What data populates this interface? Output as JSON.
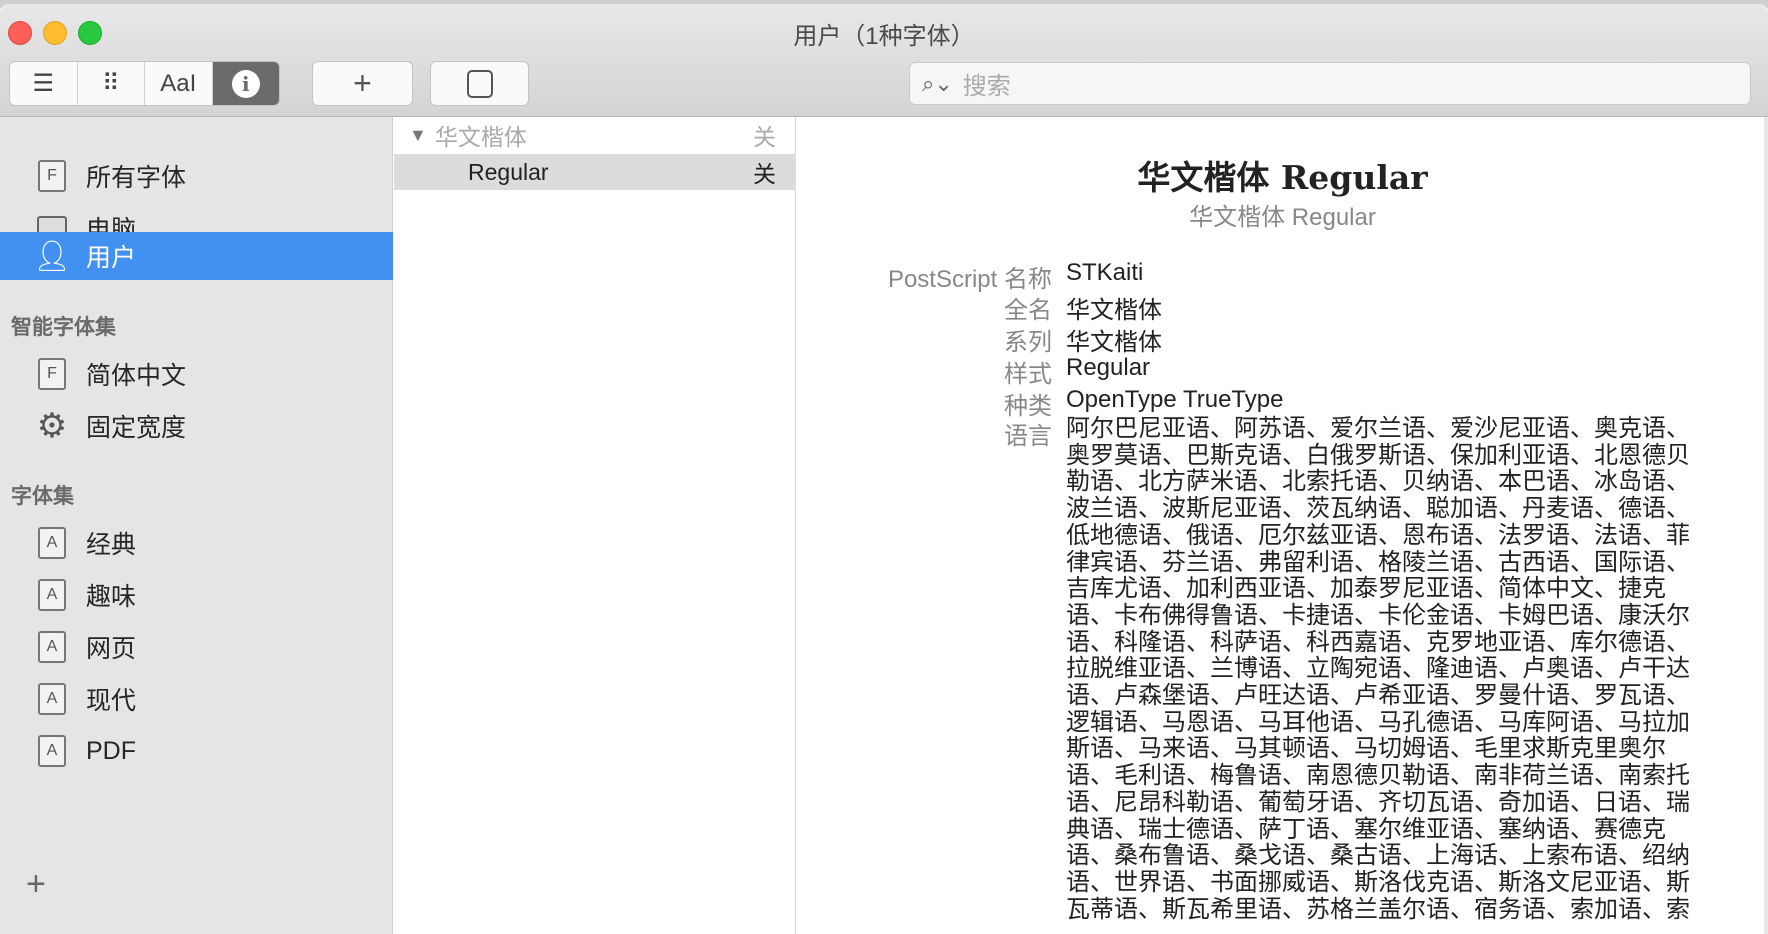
{
  "window": {
    "title": "用户（1种字体）"
  },
  "toolbar": {
    "view_buttons": [
      {
        "name": "list-view",
        "glyph": "☰"
      },
      {
        "name": "grid-view",
        "glyph": "⠿"
      },
      {
        "name": "sample-view",
        "glyph": "AaI"
      },
      {
        "name": "info-view",
        "glyph": "i"
      }
    ],
    "add_glyph": "+",
    "search_placeholder": "搜索"
  },
  "sidebar": {
    "items": [
      {
        "label": "所有字体",
        "icon": "font-book-icon"
      },
      {
        "label": "电脑",
        "icon": "computer-icon"
      },
      {
        "label": "用户",
        "icon": "user-icon",
        "selected": true
      }
    ],
    "smart_header": "智能字体集",
    "smart_items": [
      {
        "label": "简体中文",
        "icon": "font-book-icon"
      },
      {
        "label": "固定宽度",
        "icon": "gear-icon"
      }
    ],
    "collections_header": "字体集",
    "collections": [
      {
        "label": "经典"
      },
      {
        "label": "趣味"
      },
      {
        "label": "网页"
      },
      {
        "label": "现代"
      },
      {
        "label": "PDF"
      }
    ],
    "add_glyph": "+"
  },
  "font_list": {
    "family": {
      "name": "华文楷体",
      "status": "关"
    },
    "styles": [
      {
        "name": "Regular",
        "status": "关"
      }
    ]
  },
  "detail": {
    "title": "华文楷体 Regular",
    "subtitle": "华文楷体 Regular",
    "fields": [
      {
        "label": "PostScript 名称",
        "value": "STKaiti"
      },
      {
        "label": "全名",
        "value": "华文楷体"
      },
      {
        "label": "系列",
        "value": "华文楷体"
      },
      {
        "label": "样式",
        "value": "Regular"
      },
      {
        "label": "种类",
        "value": "OpenType TrueType"
      }
    ],
    "languages_label": "语言",
    "languages_lines": [
      "阿尔巴尼亚语、阿苏语、爱尔兰语、爱沙尼亚语、奥克语、",
      "奥罗莫语、巴斯克语、白俄罗斯语、保加利亚语、北恩德贝",
      "勒语、北方萨米语、北索托语、贝纳语、本巴语、冰岛语、",
      "波兰语、波斯尼亚语、茨瓦纳语、聪加语、丹麦语、德语、",
      "低地德语、俄语、厄尔兹亚语、恩布语、法罗语、法语、菲",
      "律宾语、芬兰语、弗留利语、格陵兰语、古西语、国际语、",
      "吉库尤语、加利西亚语、加泰罗尼亚语、简体中文、捷克",
      "语、卡布佛得鲁语、卡捷语、卡伦金语、卡姆巴语、康沃尔",
      "语、科隆语、科萨语、科西嘉语、克罗地亚语、库尔德语、",
      "拉脱维亚语、兰博语、立陶宛语、隆迪语、卢奥语、卢干达",
      "语、卢森堡语、卢旺达语、卢希亚语、罗曼什语、罗瓦语、",
      "逻辑语、马恩语、马耳他语、马孔德语、马库阿语、马拉加",
      "斯语、马来语、马其顿语、马切姆语、毛里求斯克里奥尔",
      "语、毛利语、梅鲁语、南恩德贝勒语、南非荷兰语、南索托",
      "语、尼昂科勒语、葡萄牙语、齐切瓦语、奇加语、日语、瑞",
      "典语、瑞士德语、萨丁语、塞尔维亚语、塞纳语、赛德克",
      "语、桑布鲁语、桑戈语、桑古语、上海话、上索布语、绍纳",
      "语、世界语、书面挪威语、斯洛伐克语、斯洛文尼亚语、斯",
      "瓦蒂语、斯瓦希里语、苏格兰盖尔语、宿务语、索加语、索"
    ]
  }
}
